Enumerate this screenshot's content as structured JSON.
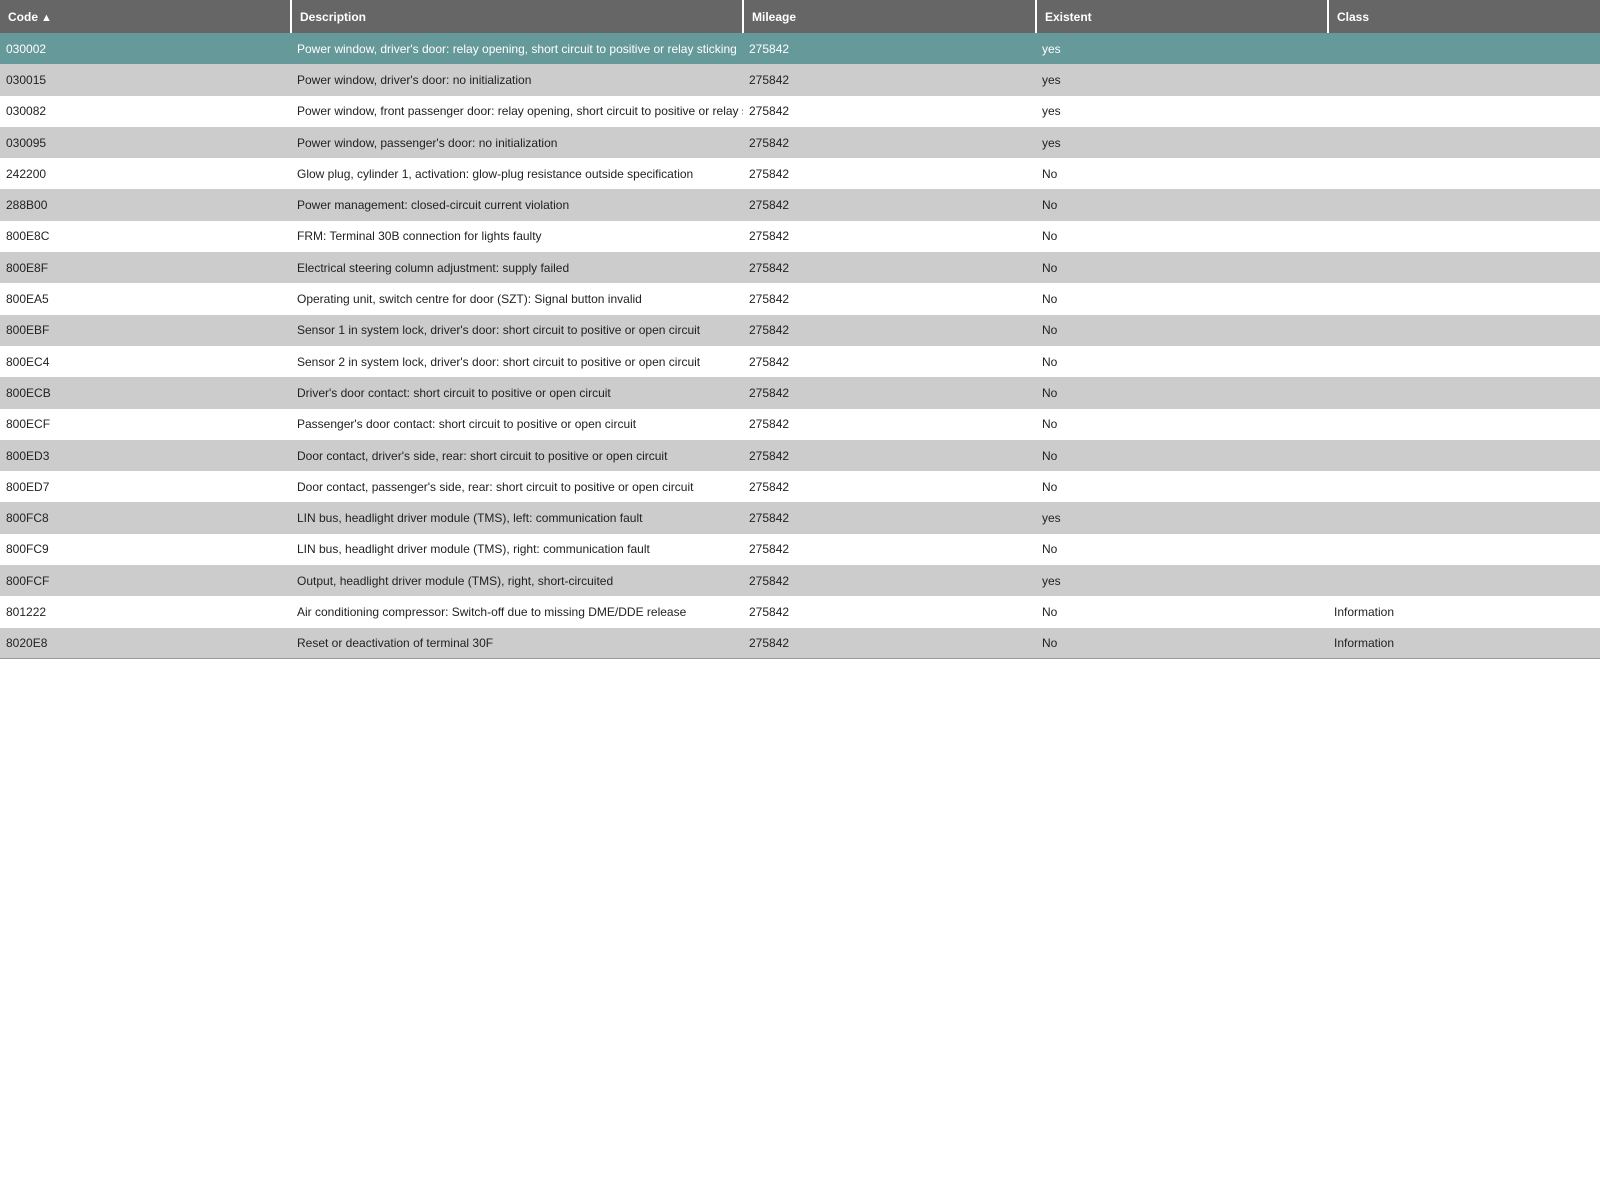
{
  "table": {
    "columns": [
      {
        "key": "code",
        "label": "Code",
        "sort": "▲"
      },
      {
        "key": "description",
        "label": "Description"
      },
      {
        "key": "mileage",
        "label": "Mileage"
      },
      {
        "key": "existent",
        "label": "Existent"
      },
      {
        "key": "class",
        "label": "Class"
      }
    ],
    "selected_row": 0,
    "rows": [
      {
        "code": "030002",
        "description": "Power window, driver's door: relay opening, short circuit to positive or relay sticking",
        "mileage": "275842",
        "existent": "yes",
        "class": ""
      },
      {
        "code": "030015",
        "description": "Power window, driver's door: no initialization",
        "mileage": "275842",
        "existent": "yes",
        "class": ""
      },
      {
        "code": "030082",
        "description": "Power window, front passenger door: relay opening, short circuit to positive or relay sticking",
        "mileage": "275842",
        "existent": "yes",
        "class": ""
      },
      {
        "code": "030095",
        "description": "Power window, passenger's door: no initialization",
        "mileage": "275842",
        "existent": "yes",
        "class": ""
      },
      {
        "code": "242200",
        "description": "Glow plug, cylinder 1, activation: glow-plug resistance outside specification",
        "mileage": "275842",
        "existent": "No",
        "class": ""
      },
      {
        "code": "288B00",
        "description": "Power management: closed-circuit current violation",
        "mileage": "275842",
        "existent": "No",
        "class": ""
      },
      {
        "code": "800E8C",
        "description": "FRM: Terminal 30B connection for lights faulty",
        "mileage": "275842",
        "existent": "No",
        "class": ""
      },
      {
        "code": "800E8F",
        "description": "Electrical steering column adjustment: supply failed",
        "mileage": "275842",
        "existent": "No",
        "class": ""
      },
      {
        "code": "800EA5",
        "description": "Operating unit, switch centre for door (SZT): Signal button invalid",
        "mileage": "275842",
        "existent": "No",
        "class": ""
      },
      {
        "code": "800EBF",
        "description": "Sensor 1 in system lock, driver's door: short circuit to positive or open circuit",
        "mileage": "275842",
        "existent": "No",
        "class": ""
      },
      {
        "code": "800EC4",
        "description": "Sensor 2 in system lock, driver's door: short circuit to positive or open circuit",
        "mileage": "275842",
        "existent": "No",
        "class": ""
      },
      {
        "code": "800ECB",
        "description": "Driver's door contact: short circuit to positive or open circuit",
        "mileage": "275842",
        "existent": "No",
        "class": ""
      },
      {
        "code": "800ECF",
        "description": "Passenger's door contact: short circuit to positive or open circuit",
        "mileage": "275842",
        "existent": "No",
        "class": ""
      },
      {
        "code": "800ED3",
        "description": "Door contact, driver's side, rear: short circuit to positive or open circuit",
        "mileage": "275842",
        "existent": "No",
        "class": ""
      },
      {
        "code": "800ED7",
        "description": "Door contact, passenger's side, rear: short circuit to positive or open circuit",
        "mileage": "275842",
        "existent": "No",
        "class": ""
      },
      {
        "code": "800FC8",
        "description": "LIN bus, headlight driver module (TMS), left: communication fault",
        "mileage": "275842",
        "existent": "yes",
        "class": ""
      },
      {
        "code": "800FC9",
        "description": "LIN bus, headlight driver module (TMS), right: communication fault",
        "mileage": "275842",
        "existent": "No",
        "class": ""
      },
      {
        "code": "800FCF",
        "description": "Output, headlight driver module (TMS), right, short-circuited",
        "mileage": "275842",
        "existent": "yes",
        "class": ""
      },
      {
        "code": "801222",
        "description": "Air conditioning compressor: Switch-off due to missing DME/DDE release",
        "mileage": "275842",
        "existent": "No",
        "class": "Information"
      },
      {
        "code": "8020E8",
        "description": "Reset or deactivation of terminal 30F",
        "mileage": "275842",
        "existent": "No",
        "class": "Information"
      }
    ]
  }
}
